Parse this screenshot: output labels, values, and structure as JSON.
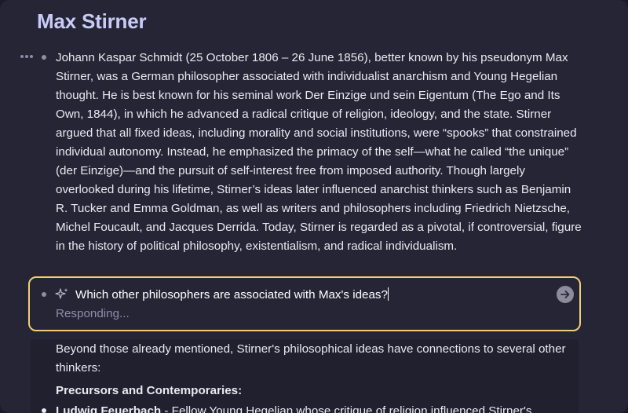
{
  "page": {
    "title": "Max Stirner"
  },
  "blocks": [
    {
      "text": "Johann Kaspar Schmidt (25 October 1806 – 26 June 1856), better known by his pseudonym Max Stirner, was a German philosopher associated with individualist anarchism and Young Hegelian thought. He is best known for his seminal work Der Einzige und sein Eigentum (The Ego and Its Own, 1844), in which he advanced a radical critique of religion, ideology, and the state. Stirner argued that all fixed ideas, including morality and social institutions, were “spooks” that constrained individual autonomy. Instead, he emphasized the primacy of the self—what he called “the unique” (der Einzige)—and the pursuit of self-interest free from imposed authority. Though largely overlooked during his lifetime, Stirner’s ideas later influenced anarchist thinkers such as Benjamin R. Tucker and Emma Goldman, as well as writers and philosophers including Friedrich Nietzsche, Michel Foucault, and Jacques Derrida. Today, Stirner is regarded as a pivotal, if controversial, figure in the history of political philosophy, existentialism, and radical individualism."
    }
  ],
  "ai_prompt": {
    "value": "Which other philosophers are associated with Max's ideas?",
    "status": "Responding...",
    "icon": "sparkle-icon",
    "send_icon": "arrow-right-icon"
  },
  "response": {
    "intro": "Beyond those already mentioned, Stirner's philosophical ideas have connections to several other thinkers:",
    "sections": [
      {
        "heading": "Precursors and Contemporaries:",
        "items": [
          {
            "name": "Ludwig Feuerbach",
            "text": " - Fellow Young Hegelian whose critique of religion influenced Stirner's"
          }
        ]
      }
    ]
  },
  "colors": {
    "background": "#252536",
    "title": "#c9ccf7",
    "text": "#e9eaf0",
    "muted": "#8d8fa6",
    "focus_border": "#f0cf77"
  }
}
